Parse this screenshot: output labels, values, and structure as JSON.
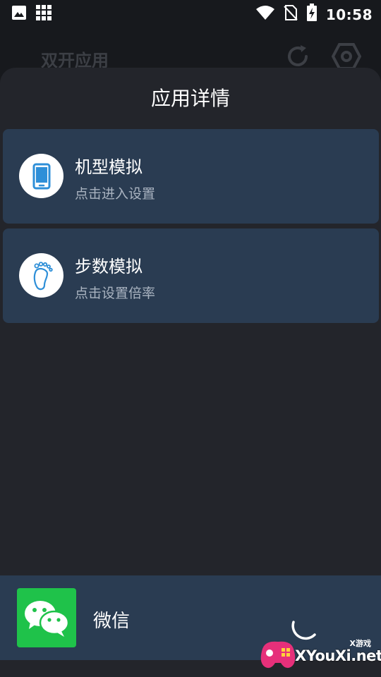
{
  "status_bar": {
    "time": "10:58",
    "icons_left": [
      "image-icon",
      "grid-icon"
    ],
    "icons_right": [
      "wifi-icon",
      "no-sim-icon",
      "battery-charging-icon"
    ]
  },
  "app_bar": {
    "title": "双开应用",
    "icons": [
      "refresh-icon",
      "settings-hexagon-icon"
    ]
  },
  "sheet": {
    "title": "应用详情",
    "items": [
      {
        "title": "机型模拟",
        "subtitle": "点击进入设置",
        "icon": "phone-icon"
      },
      {
        "title": "步数模拟",
        "subtitle": "点击设置倍率",
        "icon": "footprint-icon"
      }
    ]
  },
  "app_row": {
    "name": "微信",
    "icon": "wechat-icon"
  },
  "watermark": {
    "small": "X游戏",
    "text": "XYouXi.net"
  },
  "colors": {
    "background": "#17191d",
    "sheet": "#23252b",
    "card": "#2a3c52",
    "accent_blue": "#2e8fd8",
    "wechat_green": "#1fc24a"
  }
}
